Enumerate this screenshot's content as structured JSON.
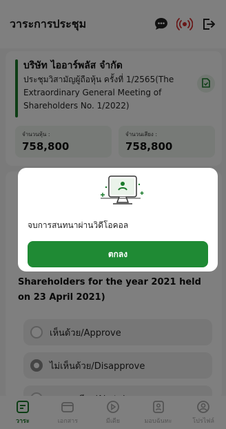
{
  "header": {
    "title": "วาระการประชุม"
  },
  "company": {
    "name": "บริษัท ไออาร์พลัส จำกัด",
    "meeting_title": "ประชุมวิสามัญผู้ถือหุ้น ครั้งที่ 1/2565(The Extraordinary General Meeting of Shareholders No. 1/2022)"
  },
  "stats": {
    "shares_label": "จำนวนหุ้น :",
    "shares_value": "758,800",
    "votes_label": "จำนวนเสียง :",
    "votes_value": "758,800"
  },
  "agenda": {
    "text": "Shareholders for the year 2021 held on 23 April 2021)",
    "options": [
      {
        "label": "เห็นด้วย/Approve",
        "selected": false
      },
      {
        "label": "ไม่เห็นด้วย/Disapprove",
        "selected": true
      },
      {
        "label": "งดออกเสียง/Abstain",
        "selected": false
      }
    ]
  },
  "modal": {
    "message": "จบการสนทนาผ่านวิดีโอคอล",
    "ok_label": "ตกลง"
  },
  "nav": {
    "items": [
      {
        "label": "วาระ",
        "icon": "agenda-icon",
        "active": true
      },
      {
        "label": "เอกสาร",
        "icon": "document-icon",
        "active": false
      },
      {
        "label": "มีเดีย",
        "icon": "media-icon",
        "active": false
      },
      {
        "label": "มอบฉันทะ",
        "icon": "proxy-icon",
        "active": false
      },
      {
        "label": "โปรไฟล์",
        "icon": "profile-icon",
        "active": false
      }
    ]
  },
  "colors": {
    "accent": "#1f8a34",
    "live": "#d32f2f"
  }
}
